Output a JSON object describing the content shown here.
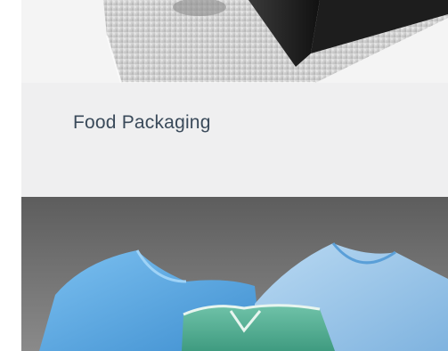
{
  "cards": [
    {
      "kind": "image",
      "icon": "packaging-box-image"
    },
    {
      "kind": "caption",
      "label": "Food Packaging"
    },
    {
      "kind": "image",
      "icon": "medical-gowns-image"
    }
  ],
  "colors": {
    "caption_bg": "#efeff0",
    "caption_text": "#3a4a5a",
    "gown_blue": "#5ea7de",
    "gown_green": "#5fb39a"
  }
}
